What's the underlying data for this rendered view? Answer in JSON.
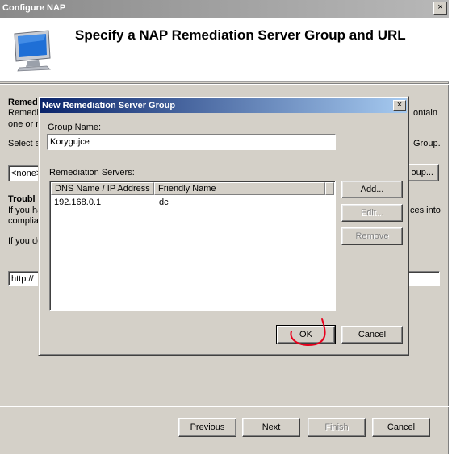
{
  "wizard": {
    "title": "Configure NAP",
    "close_glyph": "×",
    "heading": "Specify a NAP Remediation Server Group and URL",
    "icon": "monitor-icon",
    "background": {
      "section1_title": "Remed",
      "line1": "Remedi",
      "line1_right": "ontain",
      "line2": "one or n",
      "select_text": "Select a",
      "select_right": "Group.",
      "group_combo": "<none>",
      "new_group_btn": "oup...",
      "section2_title": "Troubl",
      "line3": "If you ha",
      "line3_right": "ces into",
      "line4": "complia",
      "line5": "If you do",
      "url_input": "http://"
    },
    "buttons": {
      "previous": "Previous",
      "next": "Next",
      "finish": "Finish",
      "cancel": "Cancel"
    }
  },
  "dialog": {
    "title": "New Remediation Server Group",
    "close_glyph": "×",
    "group_name_label": "Group Name:",
    "group_name_value": "Korygujce",
    "servers_label": "Remediation Servers:",
    "columns": [
      "DNS Name / IP Address",
      "Friendly Name"
    ],
    "rows": [
      {
        "address": "192.168.0.1",
        "friendly": "dc"
      }
    ],
    "add_button": "Add...",
    "edit_button": "Edit...",
    "remove_button": "Remove",
    "ok_button": "OK",
    "cancel_button": "Cancel"
  },
  "colors": {
    "title_active": "#0a246a",
    "face": "#d4d0c8",
    "annotation": "#e8001c"
  }
}
